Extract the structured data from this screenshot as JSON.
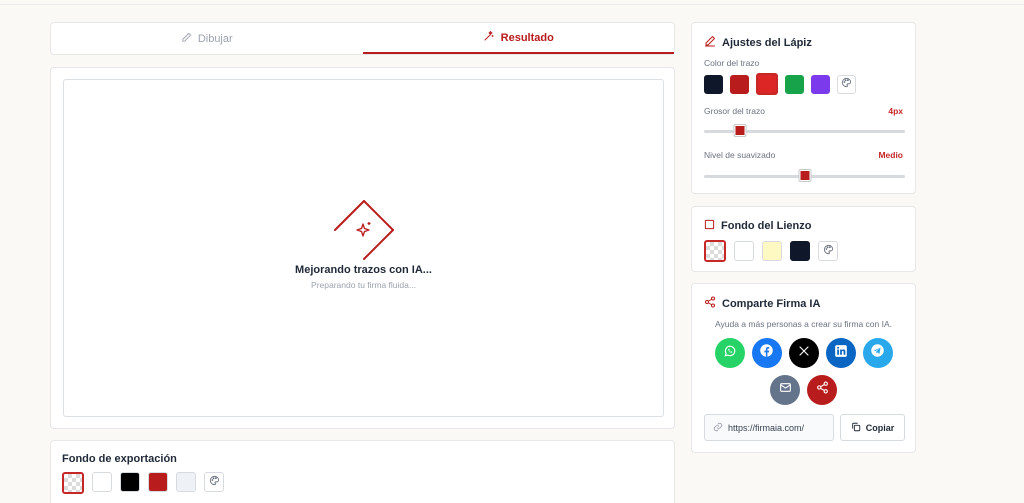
{
  "tabs": [
    {
      "label": "Dibujar",
      "icon": "pencil-icon",
      "active": false
    },
    {
      "label": "Resultado",
      "icon": "magic-wand-icon",
      "active": true
    }
  ],
  "canvas": {
    "loading_title": "Mejorando trazos con IA...",
    "loading_subtitle": "Preparando tu firma fluida..."
  },
  "export": {
    "title": "Fondo de exportación",
    "swatches": [
      "transparent",
      "#ffffff",
      "#000000",
      "#b91c1c",
      "#eef2f7"
    ],
    "selected": "transparent"
  },
  "pencil": {
    "title": "Ajustes del Lápiz",
    "color_label": "Color del trazo",
    "colors": [
      "#0f172a",
      "#b91c1c",
      "#dc2626",
      "#16a34a",
      "#7c3aed"
    ],
    "selected_color": "#dc2626",
    "thickness_label": "Grosor del trazo",
    "thickness_value": "4px",
    "thickness_fraction": 0.18,
    "smoothing_label": "Nivel de suavizado",
    "smoothing_value": "Medio",
    "smoothing_fraction": 0.5
  },
  "canvas_bg": {
    "title": "Fondo del Lienzo",
    "swatches": [
      "transparent",
      "#ffffff",
      "#fef9c3",
      "#0f172a"
    ],
    "selected": "transparent"
  },
  "share": {
    "title": "Comparte Firma IA",
    "subtitle": "Ayuda a más personas a crear su firma con IA.",
    "networks": [
      {
        "name": "whatsapp",
        "color": "#25d366"
      },
      {
        "name": "facebook",
        "color": "#1877f2"
      },
      {
        "name": "x",
        "color": "#000000"
      },
      {
        "name": "linkedin",
        "color": "#0a66c2"
      },
      {
        "name": "telegram",
        "color": "#29a9eb"
      },
      {
        "name": "email",
        "color": "#64748b"
      },
      {
        "name": "share",
        "color": "#b91c1c"
      }
    ],
    "url": "https://firmaia.com/",
    "copy_label": "Copiar"
  },
  "colors": {
    "accent": "#b91c1c"
  }
}
